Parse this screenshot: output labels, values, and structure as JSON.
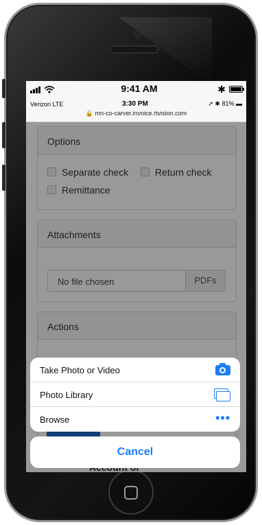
{
  "device": {
    "status_time": "9:41 AM"
  },
  "inner_status": {
    "carrier": "Verizon  LTE",
    "time": "3:30 PM",
    "battery": "81%",
    "url": "mn-co-carver.invoice.rtvision.com"
  },
  "options": {
    "title": "Options",
    "separate_check": "Separate check",
    "return_check": "Return check",
    "remittance": "Remittance"
  },
  "attachments": {
    "title": "Attachments",
    "file_status": "No file chosen",
    "button": "PDFs"
  },
  "actions": {
    "title": "Actions"
  },
  "partial_text": "Account or",
  "action_sheet": {
    "items": [
      {
        "label": "Take Photo or Video",
        "icon": "camera-icon"
      },
      {
        "label": "Photo Library",
        "icon": "photo-library-icon"
      },
      {
        "label": "Browse",
        "icon": "more-icon"
      }
    ],
    "cancel": "Cancel"
  },
  "colors": {
    "ios_blue": "#1a7ef7",
    "green_button": "#2e9e4a",
    "red_button": "#c8333b",
    "blue_button": "#1a66c4"
  }
}
